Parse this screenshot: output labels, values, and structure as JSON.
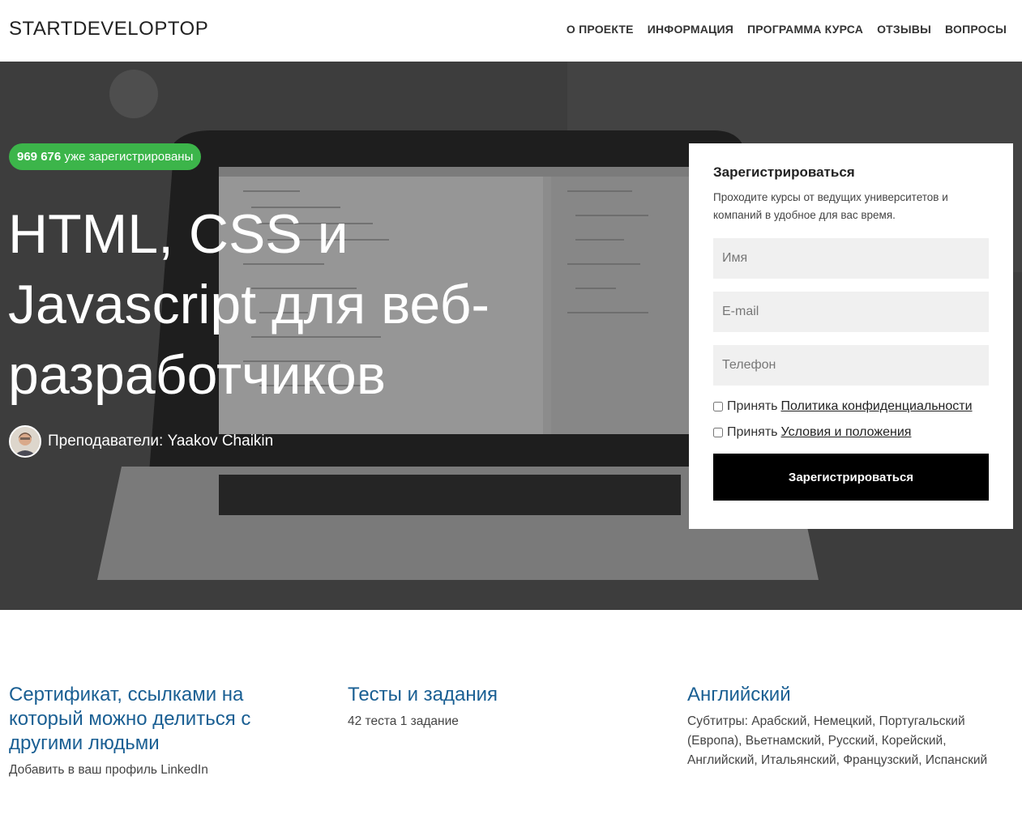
{
  "header": {
    "logo": "STARTDEVELOPTOP",
    "nav": [
      "О ПРОЕКТЕ",
      "ИНФОРМАЦИЯ",
      "ПРОГРАММА КУРСА",
      "ОТЗЫВЫ",
      "ВОПРОСЫ"
    ]
  },
  "hero": {
    "badge_count": "969 676",
    "badge_text": "уже зарегистрированы",
    "title": "HTML, CSS и Javascript для веб-разработчиков",
    "teacher_label": "Преподаватели: Yaakov Chaikin"
  },
  "form": {
    "title": "Зарегистрироваться",
    "description": "Проходите курсы от ведущих университетов и компаний в удобное для вас время.",
    "name_placeholder": "Имя",
    "email_placeholder": "E-mail",
    "phone_placeholder": "Телефон",
    "accept_label": "Принять",
    "privacy_link": "Политика конфиденциальности",
    "terms_link": "Условия и положения",
    "submit_label": "Зарегистрироваться"
  },
  "features": [
    {
      "title": "Сертификат, ссылками на который можно делиться с другими людьми",
      "text": "Добавить в ваш профиль LinkedIn"
    },
    {
      "title": "Тесты и задания",
      "text": "42 теста 1 задание"
    },
    {
      "title": "Английский",
      "text": "Субтитры: Арабский, Немецкий, Португальский (Европа), Вьетнамский, Русский, Корейский, Английский, Итальянский, Французский, Испанский"
    }
  ],
  "colors": {
    "badge": "#3cb54a",
    "feature_title": "#1a5f93",
    "submit_bg": "#000000"
  },
  "icons": {
    "avatar": "teacher-avatar-photo",
    "background": "laptop-photo"
  }
}
